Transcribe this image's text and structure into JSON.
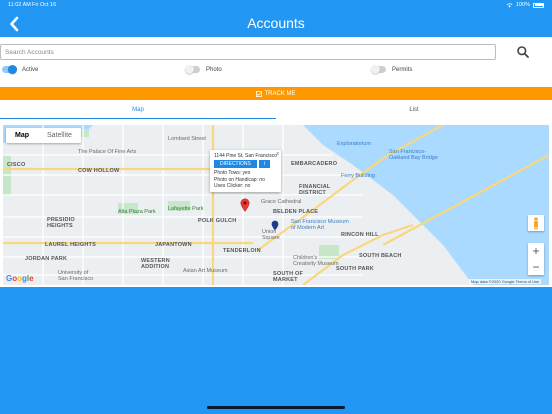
{
  "status_bar": {
    "time": "11:02 AM",
    "date": "Fri Oct 16",
    "battery": "100%"
  },
  "nav": {
    "title": "Accounts"
  },
  "search": {
    "placeholder": "Search Accounts",
    "value": ""
  },
  "filters": [
    {
      "label": "Active",
      "on": true
    },
    {
      "label": "Photo",
      "on": false
    },
    {
      "label": "Permits",
      "on": false
    }
  ],
  "track_button": {
    "label": "TRACK ME",
    "icon": "checkbox-icon"
  },
  "tabs": [
    {
      "label": "Map",
      "active": true
    },
    {
      "label": "List",
      "active": false
    }
  ],
  "map": {
    "type_control": {
      "map": "Map",
      "satellite": "Satellite"
    },
    "info_window": {
      "address": "1144 Pine St, San Francisco",
      "directions": "DIRECTIONS",
      "info_icon": "i",
      "close": "x",
      "lines": [
        "Photo Tows: yes",
        "Photo on Handicap: no",
        "Uses Clicker: no"
      ]
    },
    "labels": {
      "lombard": "Lombard Street",
      "palace": "The Palace Of Fine Arts",
      "cowhollow": "COW HOLLOW",
      "cisco": "CISCO",
      "presidio": "PRESIDIO\nHEIGHTS",
      "altaplaza": "Alta Plaza Park",
      "lafayette": "Lafayette Park",
      "polkgulch": "POLK GULCH",
      "laurel": "LAUREL HEIGHTS",
      "japantown": "JAPANTOWN",
      "jordan": "JORDAN PARK",
      "western": "WESTERN\nADDITION",
      "tenderloin": "TENDERLOIN",
      "university": "University of\nSan Francisco",
      "asian": "Asian Art Museum",
      "grace": "Grace Cathedral",
      "belden": "BELDEN PLACE",
      "financial": "FINANCIAL\nDISTRICT",
      "embarcadero": "EMBARCADERO",
      "ferry": "Ferry Building",
      "exploratorium": "Exploratorium",
      "oakland_bridge": "San Francisco-\nOakland Bay Bridge",
      "sfmoma": "San Francisco Museum\nof Modern Art",
      "rincon": "RINCON HILL",
      "union": "Union\nSquare",
      "creativity": "Children's\nCreativity Museum",
      "som": "SOUTH OF\nMARKET",
      "southbeach": "SOUTH BEACH",
      "southpark": "SOUTH PARK"
    },
    "zoom_in": "+",
    "zoom_out": "−",
    "google": "Google",
    "attribution": "Map data ©2020 Google   Terms of Use"
  },
  "colors": {
    "primary": "#2196f3",
    "accent": "#ff9800",
    "tab_active": "#1e88e5",
    "marker": "#e53935"
  }
}
